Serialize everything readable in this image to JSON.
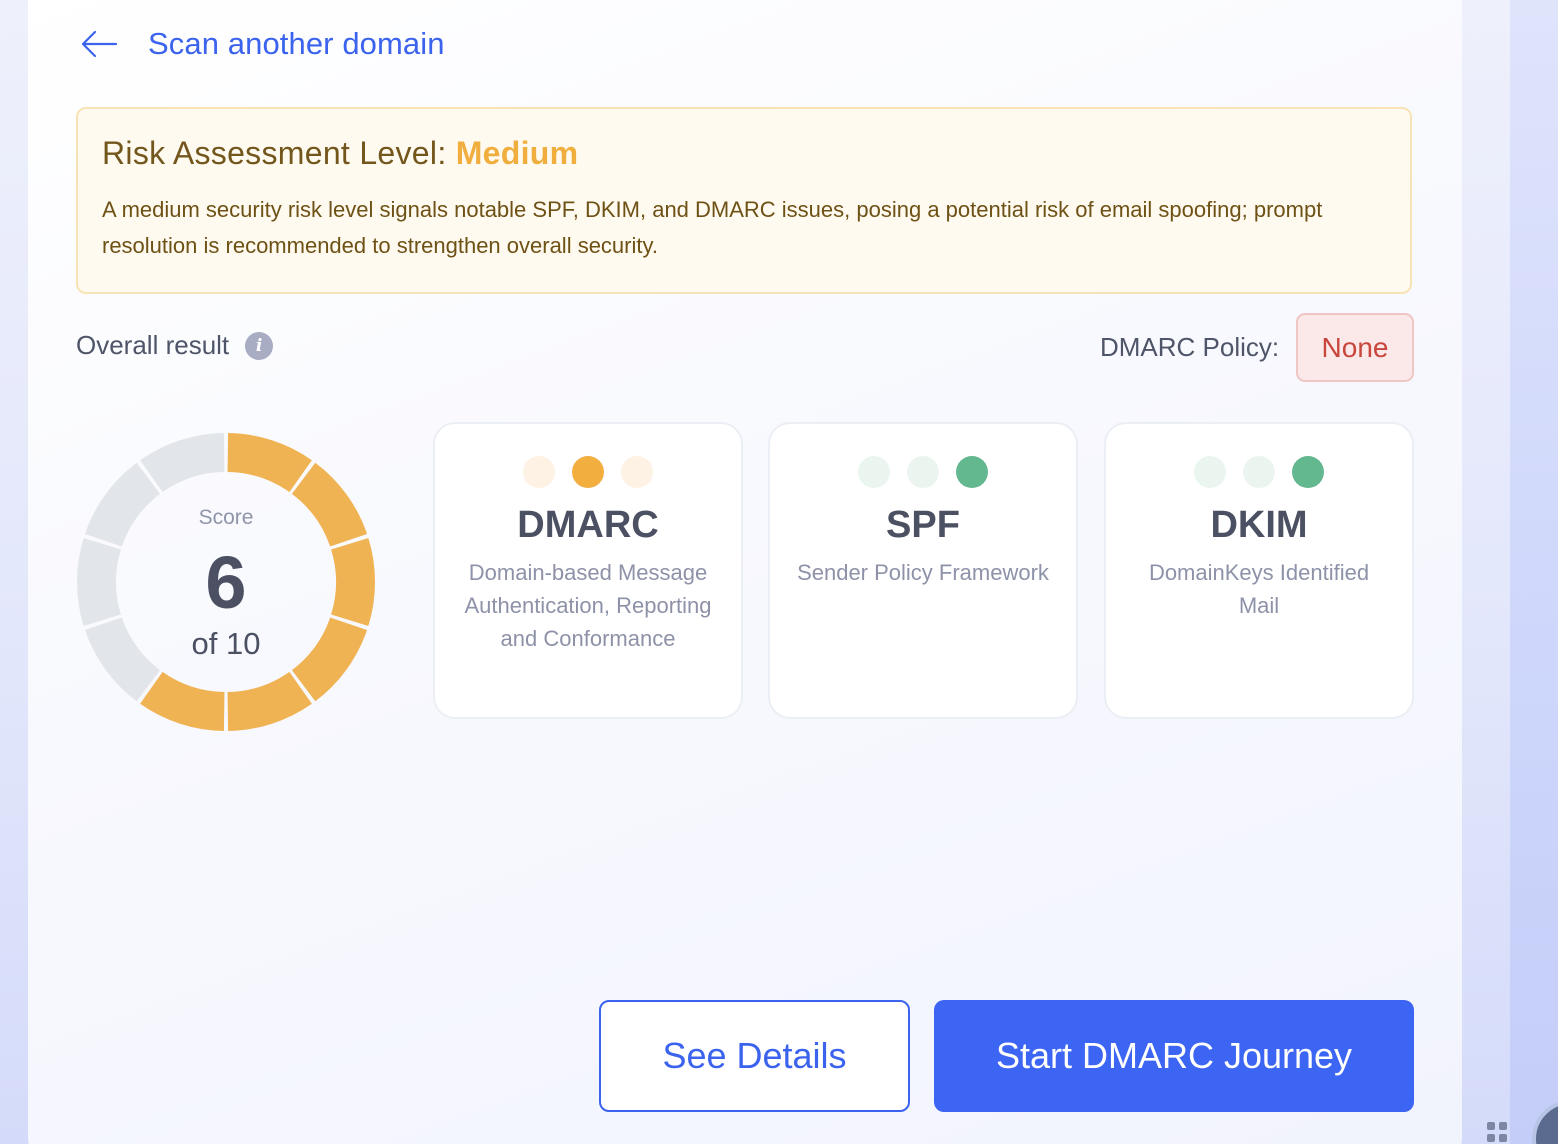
{
  "nav": {
    "back_label": "Scan another domain",
    "back_icon": "arrow-left-icon"
  },
  "risk": {
    "title_prefix": "Risk Assessment Level:",
    "level": "Medium",
    "level_color": "#f0ae3e",
    "description": "A medium security risk level signals notable SPF, DKIM, and DMARC issues, posing a potential risk of email spoofing; prompt resolution is recommended to strengthen overall security."
  },
  "overall": {
    "label": "Overall result",
    "info_icon": "info-icon",
    "info_glyph": "i"
  },
  "policy": {
    "label": "DMARC Policy:",
    "value": "None"
  },
  "score": {
    "label": "Score",
    "value": "6",
    "of_text": "of 10",
    "filled_segments": 6,
    "total_segments": 10,
    "filled_color": "#f0b354",
    "empty_color": "#e2e5ea"
  },
  "cards": [
    {
      "title": "DMARC",
      "description": "Domain-based Message Authentication, Reporting and Conformance",
      "status_level": 2,
      "dot_colors": [
        "#fdf2e4",
        "#f2ae3f",
        "#fdf2e4"
      ]
    },
    {
      "title": "SPF",
      "description": "Sender Policy Framework",
      "status_level": 3,
      "dot_colors": [
        "#ebf5f0",
        "#ebf5f0",
        "#63b890"
      ]
    },
    {
      "title": "DKIM",
      "description": "DomainKeys Identified Mail",
      "status_level": 3,
      "dot_colors": [
        "#ebf5f0",
        "#ebf5f0",
        "#63b890"
      ]
    }
  ],
  "actions": {
    "details_label": "See Details",
    "journey_label": "Start DMARC Journey"
  },
  "colors": {
    "accent": "#3d65f3",
    "policy_none_text": "#c8463c"
  }
}
